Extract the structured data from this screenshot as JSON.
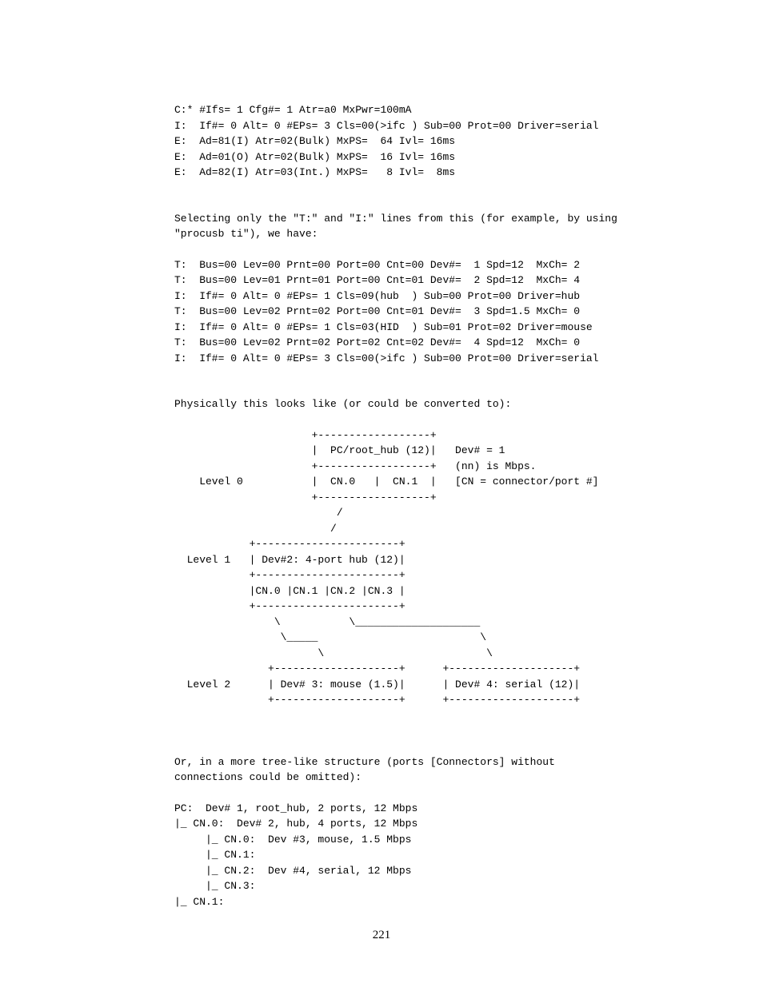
{
  "block1": "C:* #Ifs= 1 Cfg#= 1 Atr=a0 MxPwr=100mA\nI:  If#= 0 Alt= 0 #EPs= 3 Cls=00(>ifc ) Sub=00 Prot=00 Driver=serial\nE:  Ad=81(I) Atr=02(Bulk) MxPS=  64 Ivl= 16ms\nE:  Ad=01(O) Atr=02(Bulk) MxPS=  16 Ivl= 16ms\nE:  Ad=82(I) Atr=03(Int.) MxPS=   8 Ivl=  8ms",
  "block2": "Selecting only the \"T:\" and \"I:\" lines from this (for example, by using\n\"procusb ti\"), we have:",
  "block3": "T:  Bus=00 Lev=00 Prnt=00 Port=00 Cnt=00 Dev#=  1 Spd=12  MxCh= 2\nT:  Bus=00 Lev=01 Prnt=01 Port=00 Cnt=01 Dev#=  2 Spd=12  MxCh= 4\nI:  If#= 0 Alt= 0 #EPs= 1 Cls=09(hub  ) Sub=00 Prot=00 Driver=hub\nT:  Bus=00 Lev=02 Prnt=02 Port=00 Cnt=01 Dev#=  3 Spd=1.5 MxCh= 0\nI:  If#= 0 Alt= 0 #EPs= 1 Cls=03(HID  ) Sub=01 Prot=02 Driver=mouse\nT:  Bus=00 Lev=02 Prnt=02 Port=02 Cnt=02 Dev#=  4 Spd=12  MxCh= 0\nI:  If#= 0 Alt= 0 #EPs= 3 Cls=00(>ifc ) Sub=00 Prot=00 Driver=serial",
  "block4": "Physically this looks like (or could be converted to):",
  "block5": "                      +------------------+\n                      |  PC/root_hub (12)|   Dev# = 1\n                      +------------------+   (nn) is Mbps.\n    Level 0           |  CN.0   |  CN.1  |   [CN = connector/port #]\n                      +------------------+\n                          /\n                         /\n            +-----------------------+\n  Level 1   | Dev#2: 4-port hub (12)|\n            +-----------------------+\n            |CN.0 |CN.1 |CN.2 |CN.3 |\n            +-----------------------+\n                \\           \\____________________\n                 \\_____                          \\\n                       \\                          \\\n               +--------------------+      +--------------------+\n  Level 2      | Dev# 3: mouse (1.5)|      | Dev# 4: serial (12)|\n               +--------------------+      +--------------------+",
  "block6": "Or, in a more tree-like structure (ports [Connectors] without\nconnections could be omitted):",
  "block7": "PC:  Dev# 1, root_hub, 2 ports, 12 Mbps\n|_ CN.0:  Dev# 2, hub, 4 ports, 12 Mbps\n     |_ CN.0:  Dev #3, mouse, 1.5 Mbps\n     |_ CN.1:\n     |_ CN.2:  Dev #4, serial, 12 Mbps\n     |_ CN.3:\n|_ CN.1:",
  "pageNumber": "221"
}
